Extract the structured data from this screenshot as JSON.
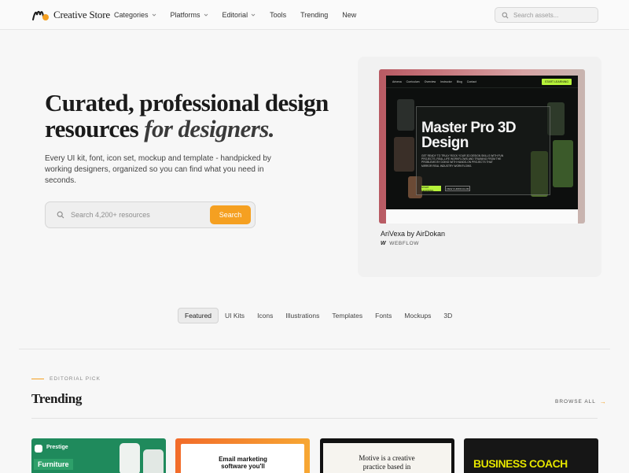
{
  "brand": {
    "name": "Creative Store",
    "accent": "#f5a021"
  },
  "nav": {
    "items": [
      {
        "label": "Categories",
        "dropdown": true
      },
      {
        "label": "Platforms",
        "dropdown": true
      },
      {
        "label": "Editorial",
        "dropdown": true
      },
      {
        "label": "Tools",
        "dropdown": false
      },
      {
        "label": "Trending",
        "dropdown": false
      },
      {
        "label": "New",
        "dropdown": false
      }
    ],
    "search_placeholder": "Search assets..."
  },
  "hero": {
    "title_line1": "Curated, professional design",
    "title_line2_plain": "resources ",
    "title_line2_italic": "for designers.",
    "subtitle": "Every UI kit, font, icon set, mockup and template - handpicked by working designers, organized so you can find what you need in seconds.",
    "search_placeholder": "Search 4,200+ resources",
    "search_button": "Search"
  },
  "feature": {
    "preview": {
      "nav_links": [
        "Arivexa",
        "Curriculum",
        "Overview",
        "Instructor",
        "Blog",
        "Contact"
      ],
      "cta": "START LEARNING",
      "headline": "Master Pro 3D Design",
      "body": "Get ready to truly rock your 3D design skills with fun projects, real-life workflows and training from the problems by doing with hands-on projects that mirror real industry workflows.",
      "btn_primary": "START LEARNING",
      "btn_secondary": "VIEW CURRICULUM"
    },
    "name": "AriVexa by AirDokan",
    "platform": "WEBFLOW"
  },
  "filters": [
    {
      "label": "Featured",
      "active": true
    },
    {
      "label": "UI Kits",
      "active": false
    },
    {
      "label": "Icons",
      "active": false
    },
    {
      "label": "Illustrations",
      "active": false
    },
    {
      "label": "Templates",
      "active": false
    },
    {
      "label": "Fonts",
      "active": false
    },
    {
      "label": "Mockups",
      "active": false
    },
    {
      "label": "3D",
      "active": false
    }
  ],
  "trending": {
    "eyebrow": "EDITORIAL PICK",
    "title": "Trending",
    "browse": "BROWSE ALL",
    "cards": [
      {
        "text_a": "Prestige",
        "text_b": "Furniture"
      },
      {
        "text_a": "Email marketing software you'll"
      },
      {
        "text_a": "Motive is a creative practice based in"
      },
      {
        "text_a": "BUSINESS COACH"
      }
    ]
  }
}
